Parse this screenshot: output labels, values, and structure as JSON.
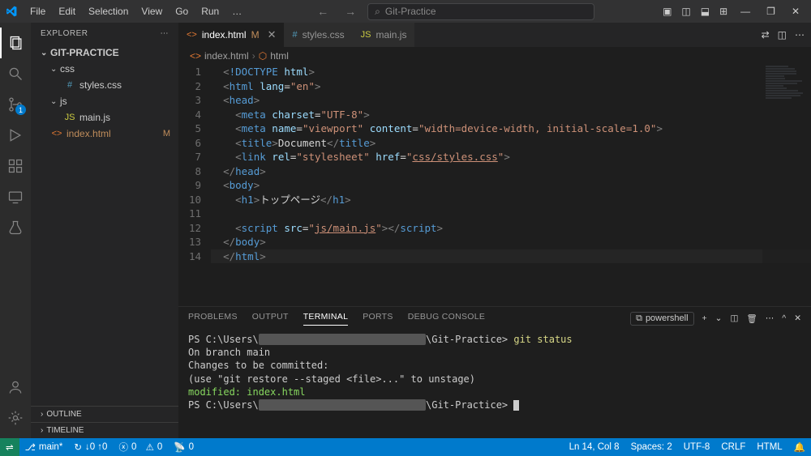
{
  "titlebar": {
    "menus": [
      "File",
      "Edit",
      "Selection",
      "View",
      "Go",
      "Run",
      "…"
    ],
    "search_placeholder": "Git-Practice",
    "nav_back": "←",
    "nav_fwd": "→"
  },
  "activity_badges": {
    "scm": "1"
  },
  "explorer": {
    "title": "EXPLORER",
    "root": "GIT-PRACTICE",
    "tree": [
      {
        "type": "folder",
        "name": "css",
        "indent": 1,
        "expanded": true
      },
      {
        "type": "file",
        "name": "styles.css",
        "indent": 2,
        "icon": "#",
        "icon_color": "#519aba"
      },
      {
        "type": "folder",
        "name": "js",
        "indent": 1,
        "expanded": true
      },
      {
        "type": "file",
        "name": "main.js",
        "indent": 2,
        "icon": "JS",
        "icon_color": "#cbcb41"
      },
      {
        "type": "file",
        "name": "index.html",
        "indent": 1,
        "icon": "<>",
        "icon_color": "#e37933",
        "modified": true
      }
    ],
    "outline_label": "OUTLINE",
    "timeline_label": "TIMELINE"
  },
  "tabs": [
    {
      "icon": "<>",
      "icon_color": "#e37933",
      "label": "index.html",
      "suffix": "M",
      "active": true,
      "closable": true
    },
    {
      "icon": "#",
      "icon_color": "#519aba",
      "label": "styles.css",
      "active": false
    },
    {
      "icon": "JS",
      "icon_color": "#cbcb41",
      "label": "main.js",
      "active": false
    }
  ],
  "breadcrumb": [
    {
      "icon": "<>",
      "text": "index.html"
    },
    {
      "icon": "⬡",
      "text": "html"
    }
  ],
  "editor": {
    "lines": [
      [
        [
          "brk",
          "<"
        ],
        [
          "tag",
          "!DOCTYPE"
        ],
        [
          "txt",
          " "
        ],
        [
          "attr",
          "html"
        ],
        [
          "brk",
          ">"
        ]
      ],
      [
        [
          "brk",
          "<"
        ],
        [
          "tag",
          "html"
        ],
        [
          "txt",
          " "
        ],
        [
          "attr",
          "lang"
        ],
        [
          "txt",
          "="
        ],
        [
          "str",
          "\"en\""
        ],
        [
          "brk",
          ">"
        ]
      ],
      [
        [
          "brk",
          "<"
        ],
        [
          "tag",
          "head"
        ],
        [
          "brk",
          ">"
        ]
      ],
      [
        [
          "txt",
          "  "
        ],
        [
          "brk",
          "<"
        ],
        [
          "tag",
          "meta"
        ],
        [
          "txt",
          " "
        ],
        [
          "attr",
          "charset"
        ],
        [
          "txt",
          "="
        ],
        [
          "str",
          "\"UTF-8\""
        ],
        [
          "brk",
          ">"
        ]
      ],
      [
        [
          "txt",
          "  "
        ],
        [
          "brk",
          "<"
        ],
        [
          "tag",
          "meta"
        ],
        [
          "txt",
          " "
        ],
        [
          "attr",
          "name"
        ],
        [
          "txt",
          "="
        ],
        [
          "str",
          "\"viewport\""
        ],
        [
          "txt",
          " "
        ],
        [
          "attr",
          "content"
        ],
        [
          "txt",
          "="
        ],
        [
          "str",
          "\"width=device-width, initial-scale=1.0\""
        ],
        [
          "brk",
          ">"
        ]
      ],
      [
        [
          "txt",
          "  "
        ],
        [
          "brk",
          "<"
        ],
        [
          "tag",
          "title"
        ],
        [
          "brk",
          ">"
        ],
        [
          "txt",
          "Document"
        ],
        [
          "brk",
          "</"
        ],
        [
          "tag",
          "title"
        ],
        [
          "brk",
          ">"
        ]
      ],
      [
        [
          "txt",
          "  "
        ],
        [
          "brk",
          "<"
        ],
        [
          "tag",
          "link"
        ],
        [
          "txt",
          " "
        ],
        [
          "attr",
          "rel"
        ],
        [
          "txt",
          "="
        ],
        [
          "str",
          "\"stylesheet\""
        ],
        [
          "txt",
          " "
        ],
        [
          "attr",
          "href"
        ],
        [
          "txt",
          "="
        ],
        [
          "str",
          "\""
        ],
        [
          "link",
          "css/styles.css"
        ],
        [
          "str",
          "\""
        ],
        [
          "brk",
          ">"
        ]
      ],
      [
        [
          "brk",
          "</"
        ],
        [
          "tag",
          "head"
        ],
        [
          "brk",
          ">"
        ]
      ],
      [
        [
          "brk",
          "<"
        ],
        [
          "tag",
          "body"
        ],
        [
          "brk",
          ">"
        ]
      ],
      [
        [
          "txt",
          "  "
        ],
        [
          "brk",
          "<"
        ],
        [
          "tag",
          "h1"
        ],
        [
          "brk",
          ">"
        ],
        [
          "txt",
          "トップページ"
        ],
        [
          "brk",
          "</"
        ],
        [
          "tag",
          "h1"
        ],
        [
          "brk",
          ">"
        ]
      ],
      [],
      [
        [
          "txt",
          "  "
        ],
        [
          "brk",
          "<"
        ],
        [
          "tag",
          "script"
        ],
        [
          "txt",
          " "
        ],
        [
          "attr",
          "src"
        ],
        [
          "txt",
          "="
        ],
        [
          "str",
          "\""
        ],
        [
          "link",
          "js/main.js"
        ],
        [
          "str",
          "\""
        ],
        [
          "brk",
          ">"
        ],
        [
          "brk",
          "</"
        ],
        [
          "tag",
          "script"
        ],
        [
          "brk",
          ">"
        ]
      ],
      [
        [
          "brk",
          "</"
        ],
        [
          "tag",
          "body"
        ],
        [
          "brk",
          ">"
        ]
      ],
      [
        [
          "brk",
          "</"
        ],
        [
          "tag",
          "html"
        ],
        [
          "brk",
          ">"
        ]
      ]
    ],
    "current_line": 14
  },
  "panel": {
    "tabs": [
      "PROBLEMS",
      "OUTPUT",
      "TERMINAL",
      "PORTS",
      "DEBUG CONSOLE"
    ],
    "active_tab": "TERMINAL",
    "dropdown": "powershell",
    "terminal_lines": [
      {
        "segments": [
          {
            "t": "PS C:\\Users\\",
            "c": ""
          },
          {
            "t": "████████████████████████████",
            "c": "blur"
          },
          {
            "t": "\\Git-Practice> ",
            "c": ""
          },
          {
            "t": "git status",
            "c": "yel"
          }
        ]
      },
      {
        "segments": [
          {
            "t": "On branch main",
            "c": ""
          }
        ]
      },
      {
        "segments": [
          {
            "t": "Changes to be committed:",
            "c": ""
          }
        ]
      },
      {
        "segments": [
          {
            "t": "  (use \"git restore --staged <file>...\" to unstage)",
            "c": ""
          }
        ]
      },
      {
        "segments": [
          {
            "t": "        modified:   index.html",
            "c": "grn"
          }
        ]
      },
      {
        "segments": [
          {
            "t": "",
            "c": ""
          }
        ]
      },
      {
        "segments": [
          {
            "t": "PS C:\\Users\\",
            "c": ""
          },
          {
            "t": "████████████████████████████",
            "c": "blur"
          },
          {
            "t": "\\Git-Practice> ",
            "c": ""
          },
          {
            "t": "",
            "c": "",
            "cursor": true
          }
        ]
      }
    ]
  },
  "statusbar": {
    "branch": "main*",
    "sync": "↓0 ↑0",
    "errors": "0",
    "warnings": "0",
    "ports": "0",
    "ln_col": "Ln 14, Col 8",
    "spaces": "Spaces: 2",
    "encoding": "UTF-8",
    "eol": "CRLF",
    "lang": "HTML"
  }
}
